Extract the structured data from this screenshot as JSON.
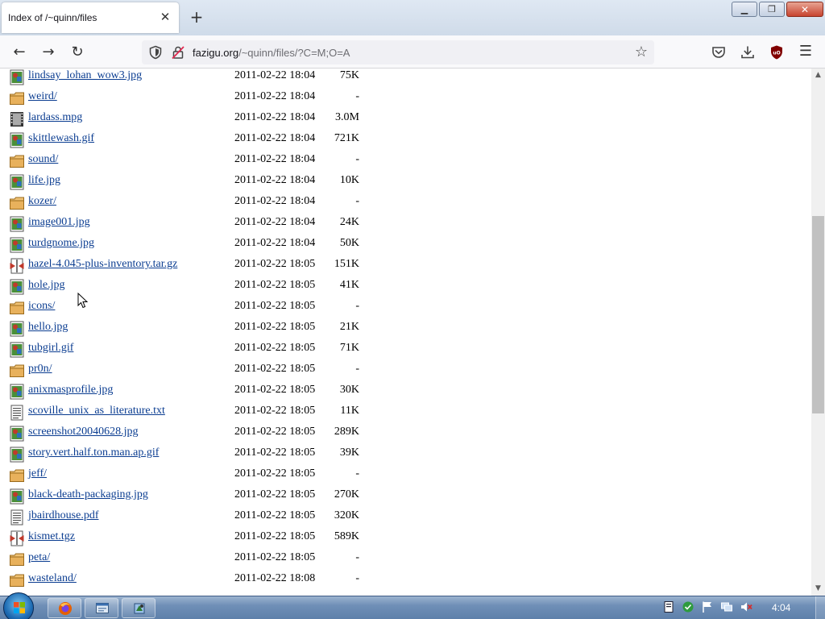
{
  "browser": {
    "tab_title": "Index of /~quinn/files",
    "tab_close_glyph": "✕",
    "new_tab_glyph": "+",
    "url_host": "fazigu.org",
    "url_path": "/~quinn/files/?C=M;O=A"
  },
  "listing": {
    "rows": [
      {
        "name": "lindsay_lohan_wow3.jpg",
        "date": "2011-02-22 18:04",
        "size": "75K",
        "icon": "image-file-icon"
      },
      {
        "name": "weird/",
        "date": "2011-02-22 18:04",
        "size": "-",
        "icon": "folder-icon"
      },
      {
        "name": "lardass.mpg",
        "date": "2011-02-22 18:04",
        "size": "3.0M",
        "icon": "video-file-icon"
      },
      {
        "name": "skittlewash.gif",
        "date": "2011-02-22 18:04",
        "size": "721K",
        "icon": "image-file-icon"
      },
      {
        "name": "sound/",
        "date": "2011-02-22 18:04",
        "size": "-",
        "icon": "folder-icon"
      },
      {
        "name": "life.jpg",
        "date": "2011-02-22 18:04",
        "size": "10K",
        "icon": "image-file-icon"
      },
      {
        "name": "kozer/",
        "date": "2011-02-22 18:04",
        "size": "-",
        "icon": "folder-icon"
      },
      {
        "name": "image001.jpg",
        "date": "2011-02-22 18:04",
        "size": "24K",
        "icon": "image-file-icon"
      },
      {
        "name": "turdgnome.jpg",
        "date": "2011-02-22 18:04",
        "size": "50K",
        "icon": "image-file-icon"
      },
      {
        "name": "hazel-4.045-plus-inventory.tar.gz",
        "date": "2011-02-22 18:05",
        "size": "151K",
        "icon": "archive-file-icon"
      },
      {
        "name": "hole.jpg",
        "date": "2011-02-22 18:05",
        "size": "41K",
        "icon": "image-file-icon"
      },
      {
        "name": "icons/",
        "date": "2011-02-22 18:05",
        "size": "-",
        "icon": "folder-icon"
      },
      {
        "name": "hello.jpg",
        "date": "2011-02-22 18:05",
        "size": "21K",
        "icon": "image-file-icon"
      },
      {
        "name": "tubgirl.gif",
        "date": "2011-02-22 18:05",
        "size": "71K",
        "icon": "image-file-icon"
      },
      {
        "name": "pr0n/",
        "date": "2011-02-22 18:05",
        "size": "-",
        "icon": "folder-icon"
      },
      {
        "name": "anixmasprofile.jpg",
        "date": "2011-02-22 18:05",
        "size": "30K",
        "icon": "image-file-icon"
      },
      {
        "name": "scoville_unix_as_literature.txt",
        "date": "2011-02-22 18:05",
        "size": "11K",
        "icon": "text-file-icon"
      },
      {
        "name": "screenshot20040628.jpg",
        "date": "2011-02-22 18:05",
        "size": "289K",
        "icon": "image-file-icon"
      },
      {
        "name": "story.vert.half.ton.man.ap.gif",
        "date": "2011-02-22 18:05",
        "size": "39K",
        "icon": "image-file-icon"
      },
      {
        "name": "jeff/",
        "date": "2011-02-22 18:05",
        "size": "-",
        "icon": "folder-icon"
      },
      {
        "name": "black-death-packaging.jpg",
        "date": "2011-02-22 18:05",
        "size": "270K",
        "icon": "image-file-icon"
      },
      {
        "name": "jbairdhouse.pdf",
        "date": "2011-02-22 18:05",
        "size": "320K",
        "icon": "text-file-icon"
      },
      {
        "name": "kismet.tgz",
        "date": "2011-02-22 18:05",
        "size": "589K",
        "icon": "archive-file-icon"
      },
      {
        "name": "peta/",
        "date": "2011-02-22 18:05",
        "size": "-",
        "icon": "folder-icon"
      },
      {
        "name": "wasteland/",
        "date": "2011-02-22 18:08",
        "size": "-",
        "icon": "folder-icon"
      }
    ]
  },
  "taskbar": {
    "clock": "4:04"
  },
  "colors": {
    "link": "#0b3d91",
    "folder": "#e8b15c",
    "taskbar": "#6f8fb7"
  }
}
